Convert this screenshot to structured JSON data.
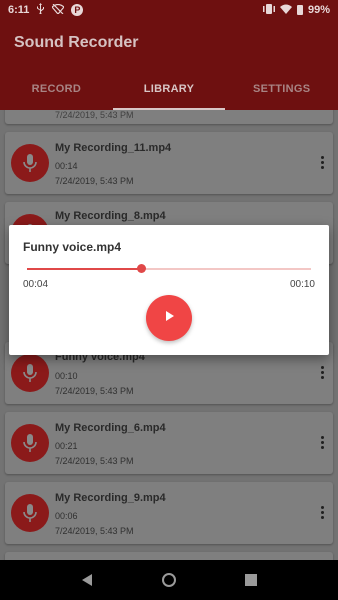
{
  "status_bar": {
    "time": "6:11",
    "battery": "99%"
  },
  "app": {
    "title": "Sound Recorder"
  },
  "tabs": [
    {
      "label": "RECORD",
      "active": false
    },
    {
      "label": "LIBRARY",
      "active": true
    },
    {
      "label": "SETTINGS",
      "active": false
    }
  ],
  "recordings": [
    {
      "name": "",
      "duration": "",
      "date": "7/24/2019, 5:43 PM"
    },
    {
      "name": "My Recording_11.mp4",
      "duration": "00:14",
      "date": "7/24/2019, 5:43 PM"
    },
    {
      "name": "My Recording_8.mp4",
      "duration": "",
      "date": ""
    },
    {
      "name": "Funny voice.mp4",
      "duration": "00:10",
      "date": "7/24/2019, 5:43 PM"
    },
    {
      "name": "My Recording_6.mp4",
      "duration": "00:21",
      "date": "7/24/2019, 5:43 PM"
    },
    {
      "name": "My Recording_9.mp4",
      "duration": "00:06",
      "date": "7/24/2019, 5:43 PM"
    }
  ],
  "player_dialog": {
    "title": "Funny voice.mp4",
    "current_time": "00:04",
    "total_time": "00:10",
    "progress": 0.4
  },
  "colors": {
    "accent": "#f04545",
    "app_bar": "#6e1010"
  },
  "icons": {
    "mic": "microphone-icon",
    "more": "more-vert-icon",
    "play": "play-icon",
    "back": "nav-back-icon",
    "home": "nav-home-icon",
    "recents": "nav-recents-icon"
  }
}
